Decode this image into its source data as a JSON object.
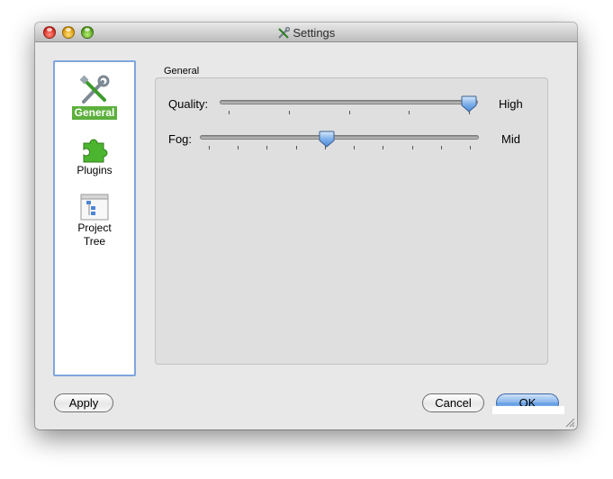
{
  "window": {
    "title": "Settings",
    "title_icon": "tools-icon"
  },
  "sidebar": {
    "items": [
      {
        "label": "General",
        "icon": "tools-icon",
        "selected": true
      },
      {
        "label": "Plugins",
        "icon": "puzzle-icon",
        "selected": false
      },
      {
        "label": "Project\nTree",
        "icon": "project-tree-icon",
        "selected": false
      }
    ]
  },
  "general": {
    "caption": "General",
    "quality": {
      "label": "Quality:",
      "value_text": "High",
      "level": 1.0,
      "ticks": 5
    },
    "fog": {
      "label": "Fog:",
      "value_text": "Mid",
      "level": 0.45,
      "ticks": 10
    }
  },
  "buttons": {
    "apply": "Apply",
    "cancel": "Cancel",
    "ok": "OK"
  },
  "colors": {
    "selection": "#5cb03c",
    "sidebar_border": "#7ea6dd",
    "default_button": "#5f9ae2"
  }
}
